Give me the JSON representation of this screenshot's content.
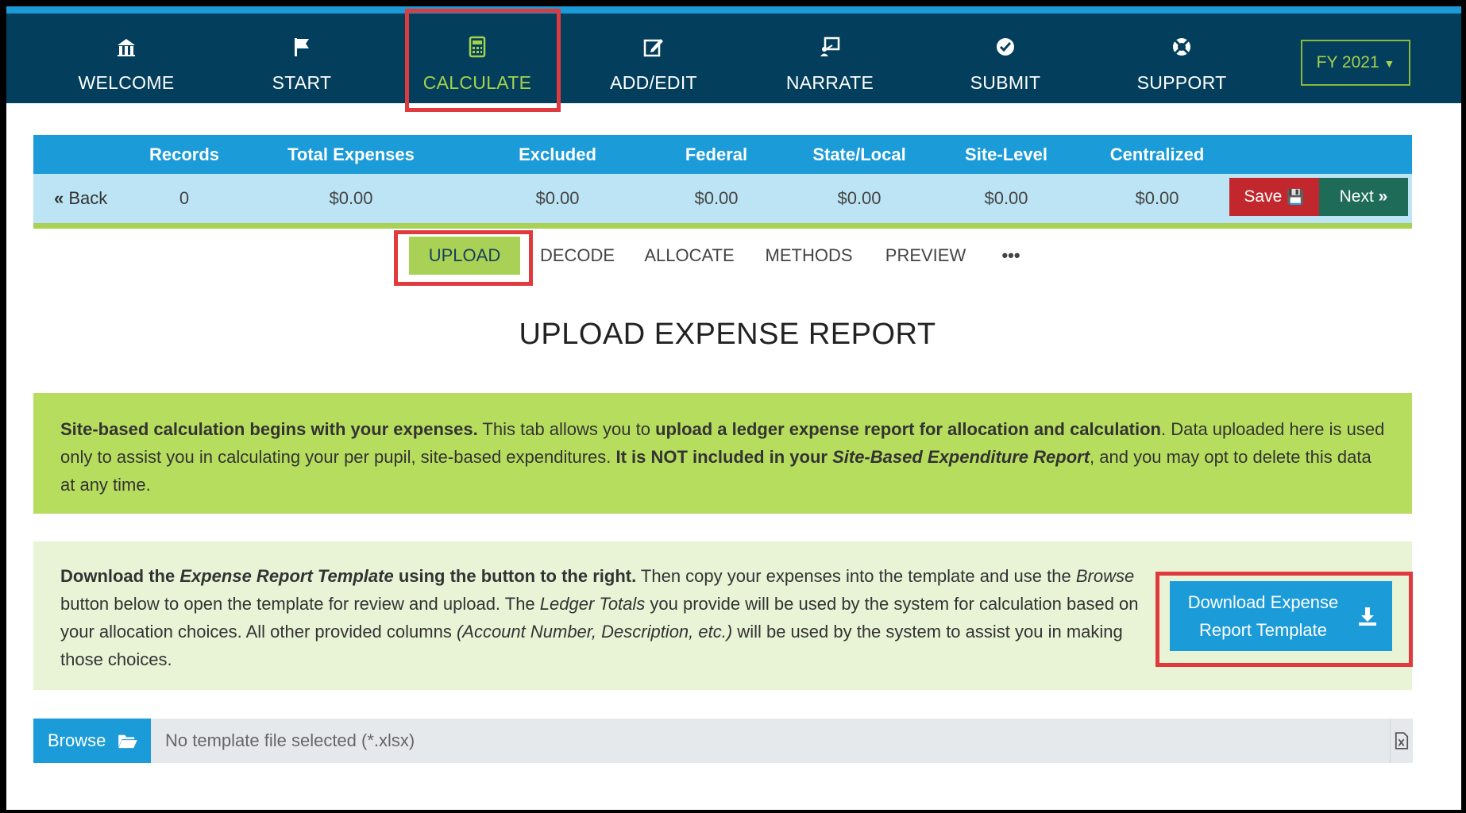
{
  "nav": {
    "items": [
      {
        "label": "WELCOME",
        "icon": "bank-icon"
      },
      {
        "label": "START",
        "icon": "flag-icon"
      },
      {
        "label": "CALCULATE",
        "icon": "calculator-icon"
      },
      {
        "label": "ADD/EDIT",
        "icon": "edit-icon"
      },
      {
        "label": "NARRATE",
        "icon": "presenter-icon"
      },
      {
        "label": "SUBMIT",
        "icon": "check-circle-icon"
      },
      {
        "label": "SUPPORT",
        "icon": "lifebuoy-icon"
      }
    ],
    "active": "CALCULATE",
    "fy_label": "FY 2021"
  },
  "summary": {
    "headers": [
      "Records",
      "Total Expenses",
      "Excluded",
      "Federal",
      "State/Local",
      "Site-Level",
      "Centralized"
    ],
    "values": [
      "0",
      "$0.00",
      "$0.00",
      "$0.00",
      "$0.00",
      "$0.00",
      "$0.00"
    ],
    "back_label": "Back",
    "save_label": "Save",
    "next_label": "Next"
  },
  "subtabs": {
    "items": [
      "UPLOAD",
      "DECODE",
      "ALLOCATE",
      "METHODS",
      "PREVIEW",
      "•••"
    ],
    "active": "UPLOAD"
  },
  "page": {
    "title": "UPLOAD EXPENSE REPORT"
  },
  "intro": {
    "b1": "Site-based calculation begins with your expenses.",
    "t1": " This tab allows you to ",
    "b2": "upload a ledger expense report for allocation and calculation",
    "t2": ". Data uploaded here is used only to assist you in calculating your per pupil, site-based expenditures. ",
    "b3": "It is NOT included in your ",
    "bi3": "Site-Based Expenditure Report",
    "t3": ", and you may opt to delete this data at any time."
  },
  "download": {
    "b1": "Download the ",
    "bi1": "Expense Report Template",
    "b2": " using the button to the right.",
    "t1": " Then copy your expenses into the template and use the ",
    "i1": "Browse",
    "t2": " button below to open the template for review and upload. The ",
    "i2": "Ledger Totals",
    "t3": " you provide will be used by the system for calculation based on your allocation choices. All other provided columns ",
    "i3": "(Account Number, Description, etc.)",
    "t4": " will be used by the system to assist you in making those choices.",
    "button_line1": "Download Expense",
    "button_line2": "Report Template"
  },
  "upload": {
    "browse_label": "Browse",
    "file_placeholder": "No template file selected (*.xlsx)"
  },
  "colors": {
    "nav_bg": "#033f5d",
    "accent_blue": "#1b9bd8",
    "accent_green": "#a8d156",
    "save_red": "#c1272d",
    "next_green": "#1e6b57",
    "highlight_red": "#e0393e"
  }
}
